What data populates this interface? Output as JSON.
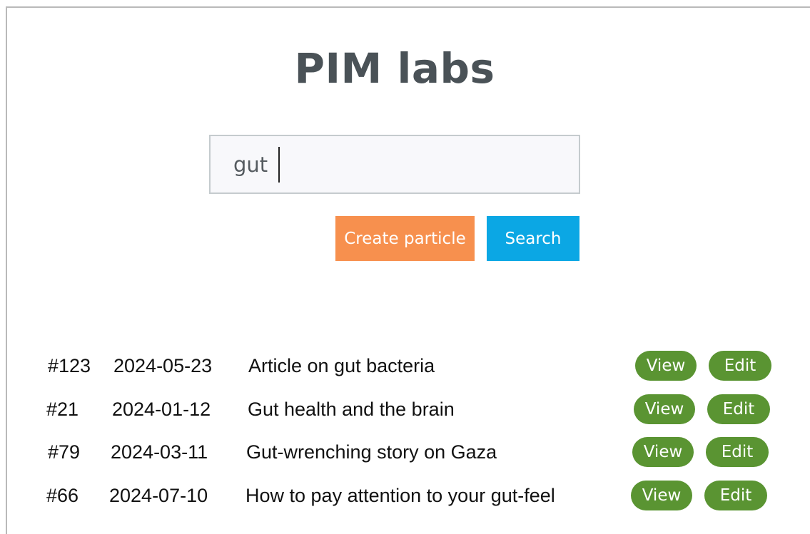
{
  "app": {
    "title": "PIM labs"
  },
  "search": {
    "value": "gut",
    "placeholder": ""
  },
  "actions": {
    "create_label": "Create particle",
    "search_label": "Search"
  },
  "colors": {
    "title": "#4a5257",
    "create_button": "#f7904e",
    "search_button": "#0ba7e4",
    "row_button": "#5a9432"
  },
  "results": [
    {
      "id": "#123",
      "date": "2024-05-23",
      "title": "Article on gut bacteria",
      "view_label": "View",
      "edit_label": "Edit"
    },
    {
      "id": "#21",
      "date": "2024-01-12",
      "title": "Gut health and the brain",
      "view_label": "View",
      "edit_label": "Edit"
    },
    {
      "id": "#79",
      "date": "2024-03-11",
      "title": "Gut-wrenching story on Gaza",
      "view_label": "View",
      "edit_label": "Edit"
    },
    {
      "id": "#66",
      "date": "2024-07-10",
      "title": "How to pay attention to your gut-feel",
      "view_label": "View",
      "edit_label": "Edit"
    }
  ]
}
